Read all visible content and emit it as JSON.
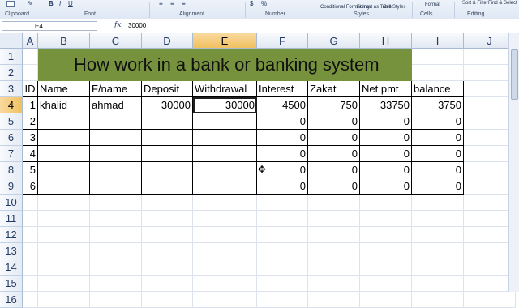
{
  "ribbon": {
    "groups": [
      "Clipboard",
      "Font",
      "Alignment",
      "Number",
      "Styles",
      "Cells",
      "Editing"
    ],
    "styles_items": [
      "Conditional Formatting",
      "Format as Table",
      "Cell Styles"
    ],
    "cells_item": "Format",
    "editing_items": [
      "Sort & Filter",
      "Find & Select"
    ]
  },
  "formula_bar": {
    "name_box": "E4",
    "fx_label": "fx",
    "formula": "30000"
  },
  "sheet": {
    "columns": [
      "A",
      "B",
      "C",
      "D",
      "E",
      "F",
      "G",
      "H",
      "I",
      "J"
    ],
    "rows": [
      "1",
      "2",
      "3",
      "4",
      "5",
      "6",
      "7",
      "8",
      "9",
      "10",
      "11",
      "12",
      "13",
      "14",
      "15",
      "16"
    ],
    "title": "How work in a bank or banking system",
    "headers": [
      "ID",
      "Name",
      "F/name",
      "Deposit",
      "Withdrawal",
      "Interest",
      "Zakat",
      "Net pmt",
      "balance"
    ],
    "data": [
      [
        "1",
        "khalid",
        "ahmad",
        "30000",
        "30000",
        "4500",
        "750",
        "33750",
        "3750"
      ],
      [
        "2",
        "",
        "",
        "",
        "",
        "0",
        "0",
        "0",
        "0"
      ],
      [
        "3",
        "",
        "",
        "",
        "",
        "0",
        "0",
        "0",
        "0"
      ],
      [
        "4",
        "",
        "",
        "",
        "",
        "0",
        "0",
        "0",
        "0"
      ],
      [
        "5",
        "",
        "",
        "",
        "",
        "0",
        "0",
        "0",
        "0"
      ],
      [
        "6",
        "",
        "",
        "",
        "",
        "0",
        "0",
        "0",
        "0"
      ]
    ],
    "active_cell": "E4"
  }
}
